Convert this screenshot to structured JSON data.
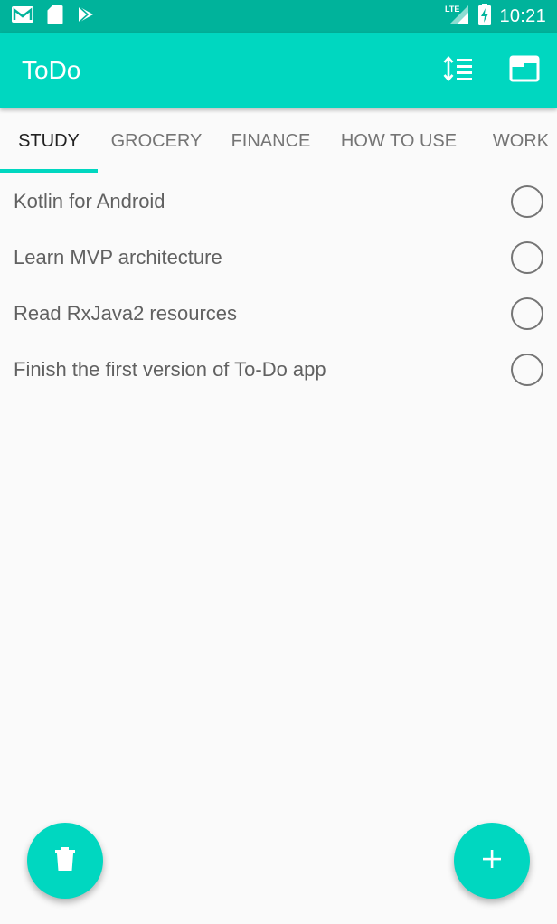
{
  "status_bar": {
    "time": "10:21",
    "network": "LTE",
    "icons": [
      "gmail-icon",
      "sd-card-icon",
      "play-store-icon",
      "signal-icon",
      "battery-charging-icon"
    ]
  },
  "app_bar": {
    "title": "ToDo",
    "actions": [
      "sort-icon",
      "open-window-icon"
    ],
    "color": "#00d7c0"
  },
  "tabs": [
    {
      "label": "STUDY",
      "active": true
    },
    {
      "label": "GROCERY",
      "active": false
    },
    {
      "label": "FINANCE",
      "active": false
    },
    {
      "label": "HOW TO USE",
      "active": false
    },
    {
      "label": "WORK",
      "active": false
    }
  ],
  "tasks": [
    {
      "label": "Kotlin for Android",
      "done": false
    },
    {
      "label": "Learn MVP architecture",
      "done": false
    },
    {
      "label": "Read RxJava2 resources",
      "done": false
    },
    {
      "label": "Finish the first version of To-Do app",
      "done": false
    }
  ],
  "fabs": {
    "delete_icon": "trash-icon",
    "add_icon": "plus-icon"
  },
  "colors": {
    "accent": "#00d7c0",
    "status_bar": "#00b39b",
    "background": "#fafafa"
  }
}
